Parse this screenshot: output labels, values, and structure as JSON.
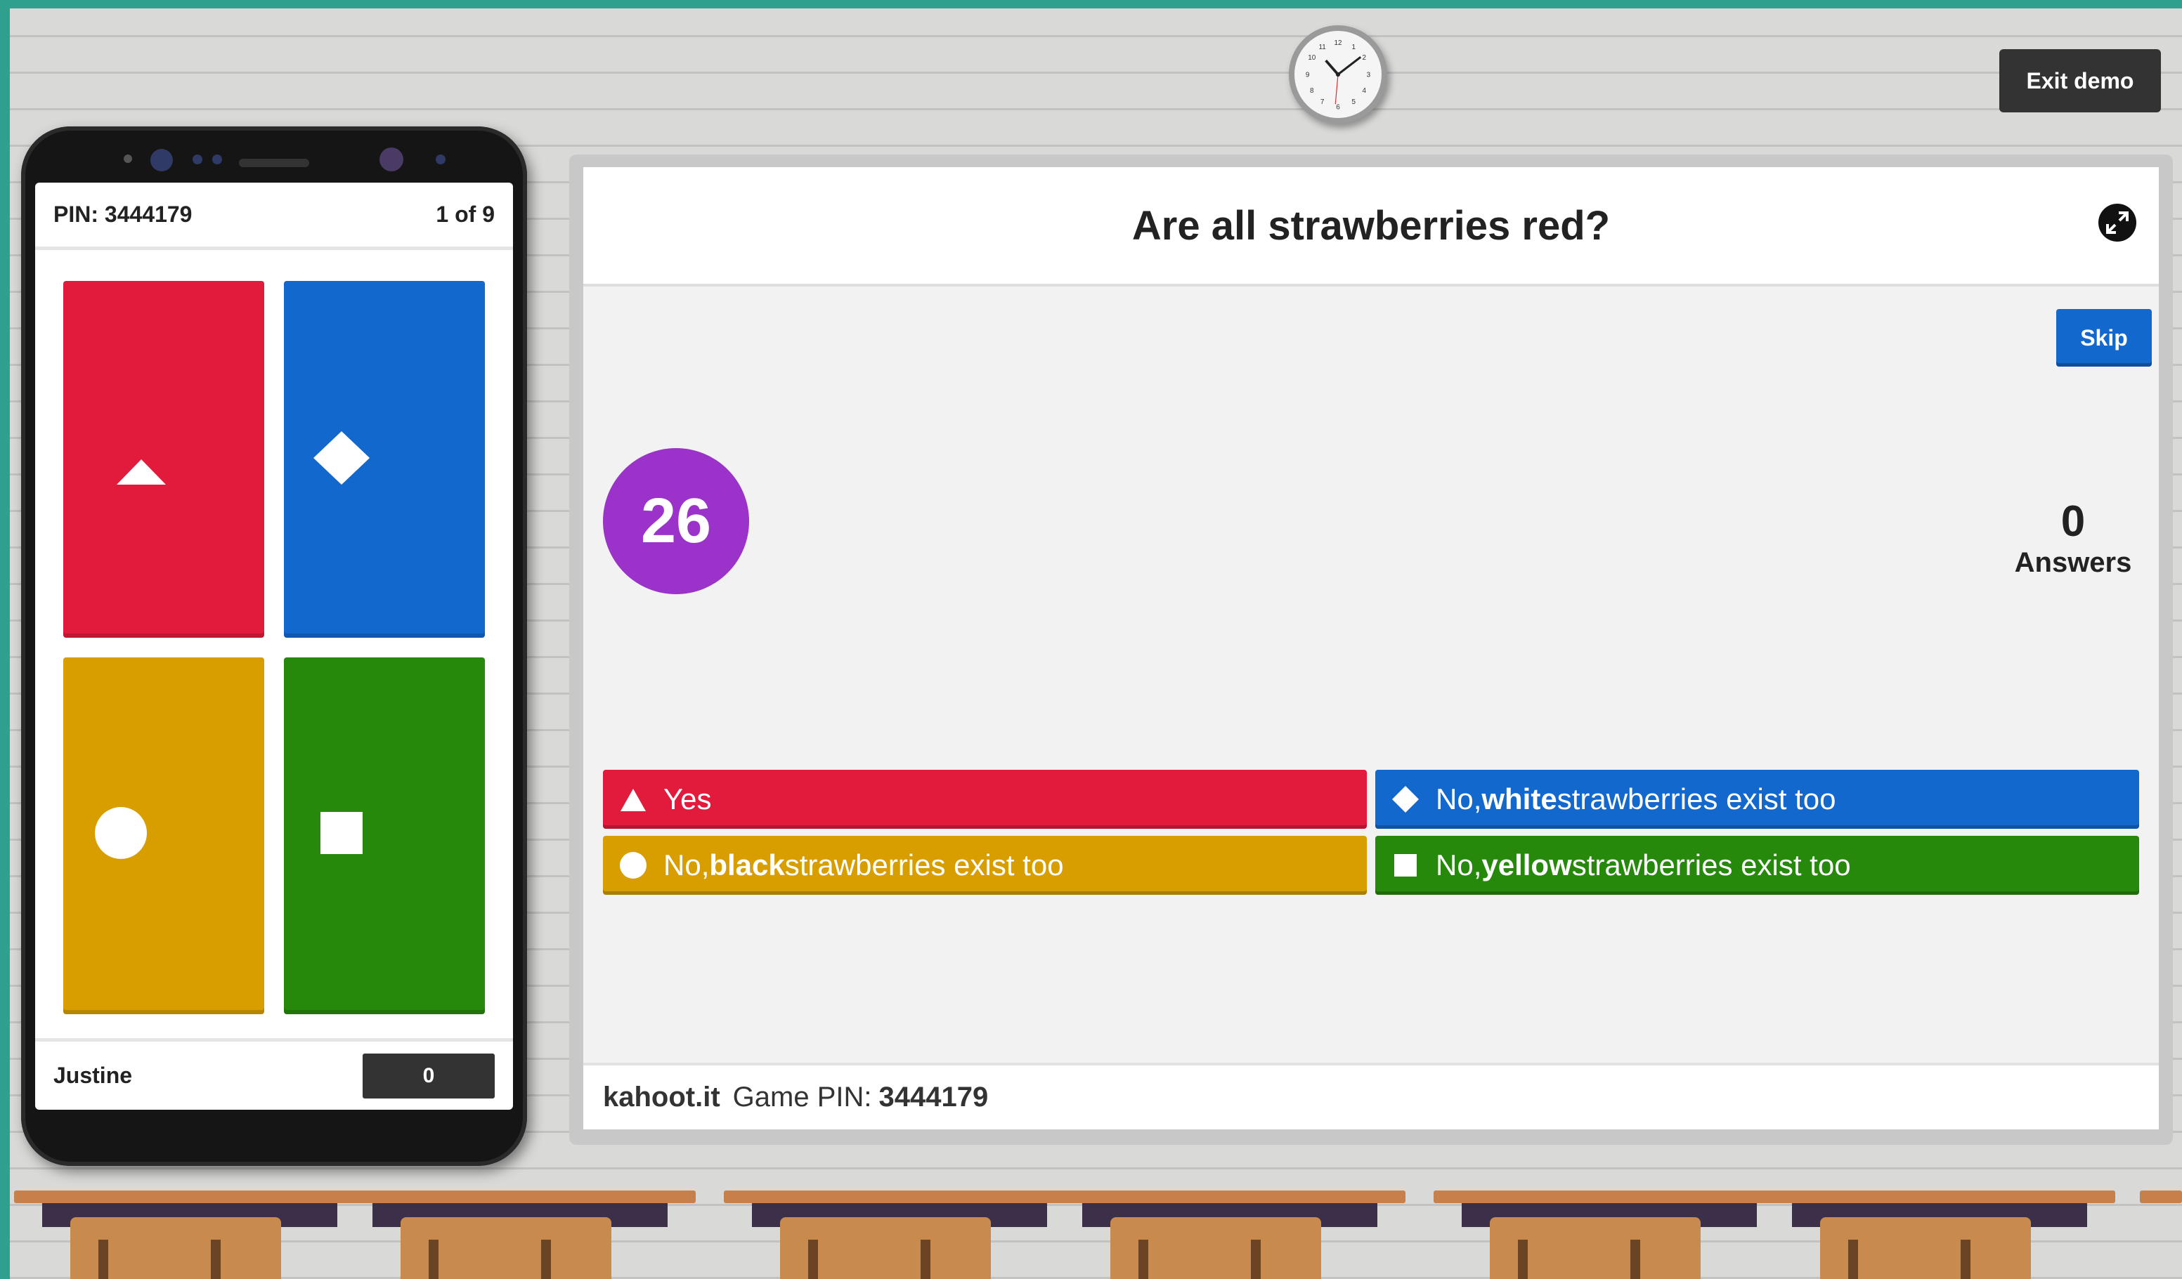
{
  "colors": {
    "red": "#e21b3c",
    "blue": "#1368ce",
    "yellow": "#d89e00",
    "green": "#26890c",
    "timer": "#9b32c9",
    "teal_frame": "#2fa08e"
  },
  "top": {
    "exit_label": "Exit demo",
    "clock_icon": "wall-clock-icon"
  },
  "phone": {
    "pin_label": "PIN: 3444179",
    "progress": "1 of 9",
    "player_name": "Justine",
    "score": "0",
    "tiles": [
      {
        "shape": "triangle-icon",
        "color": "red"
      },
      {
        "shape": "diamond-icon",
        "color": "blue"
      },
      {
        "shape": "circle-icon",
        "color": "yellow"
      },
      {
        "shape": "square-icon",
        "color": "green"
      }
    ]
  },
  "board": {
    "question": "Are all strawberries red?",
    "fullscreen_icon": "fullscreen-icon",
    "skip_label": "Skip",
    "timer": "26",
    "answers_count": "0",
    "answers_label": "Answers",
    "answers": [
      {
        "shape": "triangle-icon",
        "color": "red",
        "prefix": "Yes",
        "bold": "",
        "suffix": ""
      },
      {
        "shape": "diamond-icon",
        "color": "blue",
        "prefix": "No, ",
        "bold": "white",
        "suffix": " strawberries exist too"
      },
      {
        "shape": "circle-icon",
        "color": "yellow",
        "prefix": "No, ",
        "bold": "black",
        "suffix": " strawberries exist too"
      },
      {
        "shape": "square-icon",
        "color": "green",
        "prefix": "No, ",
        "bold": "yellow",
        "suffix": " strawberries exist too"
      }
    ],
    "footer": {
      "site": "kahoot.it",
      "pin_label": "Game PIN:",
      "pin": "3444179"
    }
  }
}
